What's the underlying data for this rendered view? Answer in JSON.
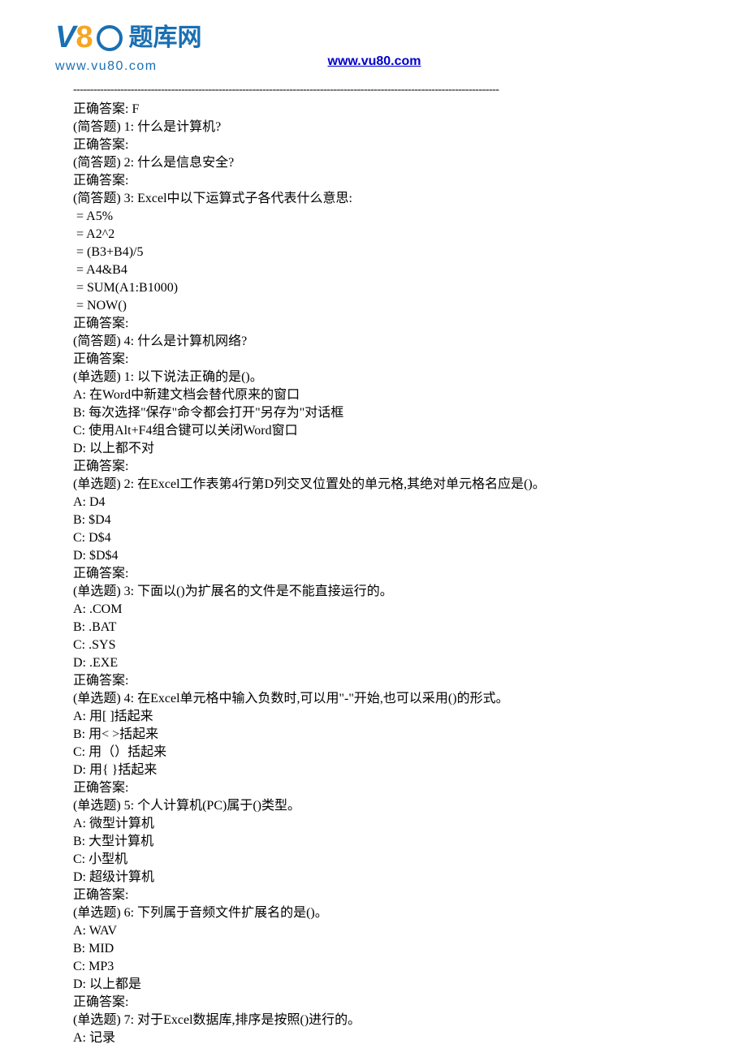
{
  "header": {
    "logo_cn": "题库网",
    "logo_url": "www.vu80.com",
    "link_text": "www.vu80.com",
    "link_href": "http://www.vu80.com"
  },
  "divider": "------------------------------------------------------------------------------------------------------------------------------",
  "lines": [
    "正确答案: F",
    "(简答题) 1: 什么是计算机?",
    "正确答案:",
    "(简答题) 2: 什么是信息安全?",
    "正确答案:",
    "(简答题) 3: Excel中以下运算式子各代表什么意思:",
    " = A5%",
    " = A2^2",
    " = (B3+B4)/5",
    " = A4&B4",
    " = SUM(A1:B1000)",
    " = NOW()",
    "正确答案:",
    "(简答题) 4: 什么是计算机网络?",
    "正确答案:",
    "(单选题) 1: 以下说法正确的是()。",
    "A: 在Word中新建文档会替代原来的窗口",
    "B: 每次选择\"保存\"命令都会打开\"另存为\"对话框",
    "C: 使用Alt+F4组合键可以关闭Word窗口",
    "D: 以上都不对",
    "正确答案:",
    "(单选题) 2: 在Excel工作表第4行第D列交叉位置处的单元格,其绝对单元格名应是()。",
    "A: D4",
    "B: $D4",
    "C: D$4",
    "D: $D$4",
    "正确答案:",
    "(单选题) 3: 下面以()为扩展名的文件是不能直接运行的。",
    "A: .COM",
    "B: .BAT",
    "C: .SYS",
    "D: .EXE",
    "正确答案:",
    "(单选题) 4: 在Excel单元格中输入负数时,可以用\"-\"开始,也可以采用()的形式。",
    "A: 用[ ]括起来",
    "B: 用< >括起来",
    "C: 用（）括起来",
    "D: 用{ }括起来",
    "正确答案:",
    "(单选题) 5: 个人计算机(PC)属于()类型。",
    "A: 微型计算机",
    "B: 大型计算机",
    "C: 小型机",
    "D: 超级计算机",
    "正确答案:",
    "(单选题) 6: 下列属于音频文件扩展名的是()。",
    "A: WAV",
    "B: MID",
    "C: MP3",
    "D: 以上都是",
    "正确答案:",
    "(单选题) 7: 对于Excel数据库,排序是按照()进行的。",
    "A: 记录"
  ]
}
